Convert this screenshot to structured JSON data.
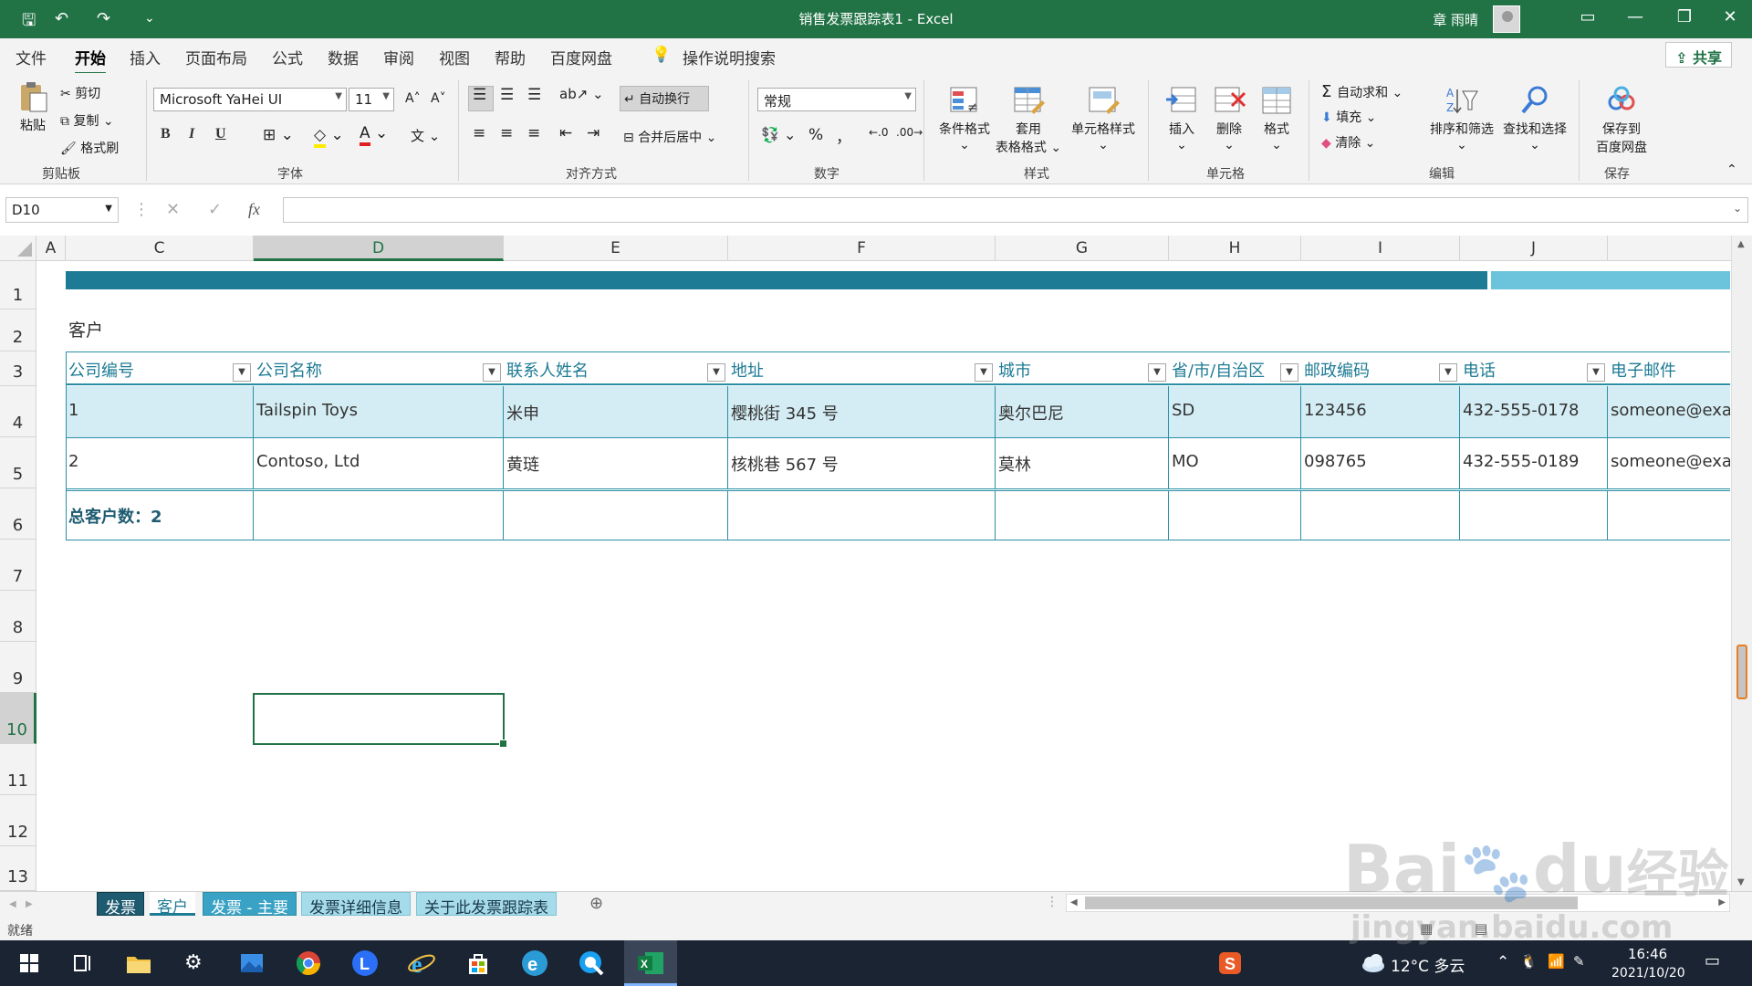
{
  "window": {
    "title": "销售发票跟踪表1  -  Excel",
    "user_name": "章 雨晴",
    "qa_save": "🖫",
    "qa_undo": "↶",
    "qa_redo": "↷",
    "qa_more": "⌄"
  },
  "menu": {
    "tabs": [
      "文件",
      "开始",
      "插入",
      "页面布局",
      "公式",
      "数据",
      "审阅",
      "视图",
      "帮助",
      "百度网盘"
    ],
    "active": "开始",
    "search": "操作说明搜索",
    "share": "共享"
  },
  "ribbon": {
    "clipboard": {
      "paste": "粘贴",
      "cut": "剪切",
      "copy": "复制",
      "painter": "格式刷",
      "label": "剪贴板"
    },
    "font": {
      "name": "Microsoft YaHei UI",
      "size": "11",
      "label": "字体",
      "bold": "B",
      "italic": "I",
      "underline": "U"
    },
    "alignment": {
      "wrap": "自动换行",
      "merge": "合并后居中",
      "label": "对齐方式"
    },
    "number": {
      "format": "常规",
      "percent": "%",
      "comma": "，",
      "label": "数字"
    },
    "styles": {
      "conditional": "条件格式",
      "table_format_line1": "套用",
      "table_format_line2": "表格格式",
      "cell_styles": "单元格样式",
      "label": "样式"
    },
    "cells": {
      "insert": "插入",
      "delete": "删除",
      "format": "格式",
      "label": "单元格"
    },
    "editing": {
      "autosum": "自动求和",
      "fill": "填充",
      "clear": "清除",
      "sort": "排序和筛选",
      "find": "查找和选择",
      "label": "编辑"
    },
    "save": {
      "line1": "保存到",
      "line2": "百度网盘",
      "label": "保存"
    }
  },
  "formula_bar": {
    "name_box": "D10",
    "cancel": "✕",
    "enter": "✓",
    "fx": "fx",
    "value": ""
  },
  "grid": {
    "columns": [
      "A",
      "C",
      "D",
      "E",
      "F",
      "G",
      "H",
      "I",
      "J"
    ],
    "rows": [
      "1",
      "2",
      "3",
      "4",
      "5",
      "6",
      "7",
      "8",
      "9",
      "10",
      "11",
      "12",
      "13"
    ],
    "selected_column": "D",
    "selected_row": "10"
  },
  "sheet": {
    "title": "客户",
    "headers": [
      "公司编号",
      "公司名称",
      "联系人姓名",
      "地址",
      "城市",
      "省/市/自治区",
      "邮政编码",
      "电话",
      "电子邮件"
    ],
    "rows": [
      [
        "1",
        "Tailspin Toys",
        "米申",
        "樱桃街 345 号",
        "奥尔巴尼",
        "SD",
        "123456",
        "432-555-0178",
        "someone@exa"
      ],
      [
        "2",
        "Contoso, Ltd",
        "黄琏",
        "核桃巷 567 号",
        "莫林",
        "MO",
        "098765",
        "432-555-0189",
        "someone@exa"
      ]
    ],
    "total": "总客户数：2",
    "colors": {
      "header_text": "#1e7b95",
      "band_dark": "#1e7b95",
      "band_light": "#6cc4dc",
      "row_highlight": "#d4edf4"
    }
  },
  "sheet_tabs": [
    {
      "label": "发票",
      "style": "dark"
    },
    {
      "label": "客户",
      "style": "active"
    },
    {
      "label": "发票 - 主要",
      "style": "teal"
    },
    {
      "label": "发票详细信息",
      "style": "light"
    },
    {
      "label": "关于此发票跟踪表",
      "style": "light"
    }
  ],
  "status": {
    "ready": "就绪"
  },
  "taskbar": {
    "weather": "12°C  多云",
    "time": "16:46",
    "date": "2021/10/20"
  },
  "watermark": {
    "brand": "Bai",
    "brand_suffix": "du",
    "brand_cn": "经验",
    "url": "jingyan.baidu.com"
  }
}
